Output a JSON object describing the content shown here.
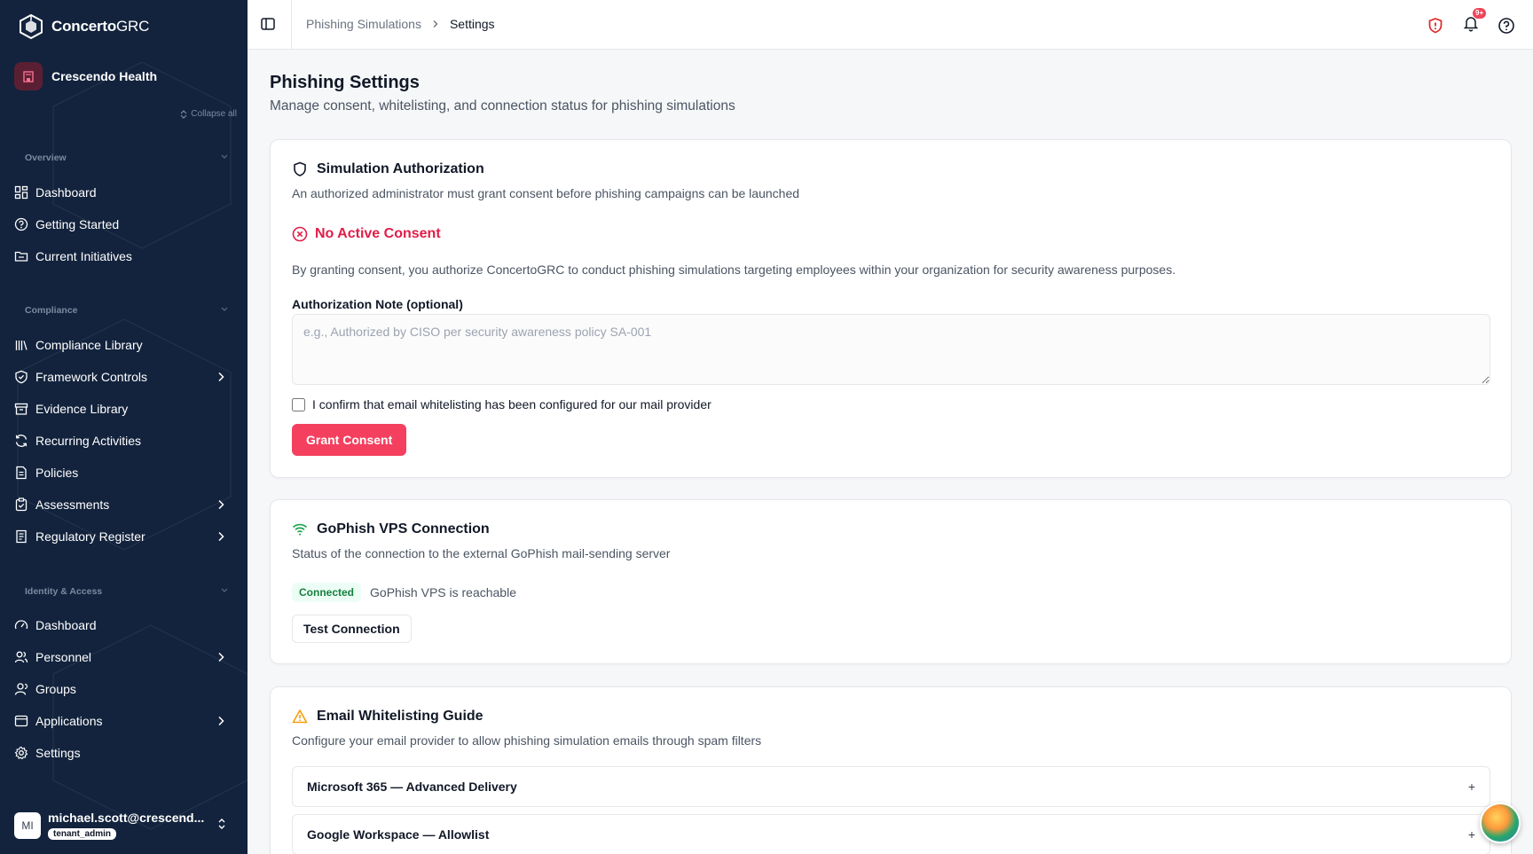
{
  "brand": {
    "name_bold": "Concerto",
    "name_light": "GRC"
  },
  "org": {
    "name": "Crescendo Health"
  },
  "sidebar": {
    "collapse_all": "Collapse all",
    "sections": [
      {
        "label": "Overview",
        "items": [
          {
            "label": "Dashboard",
            "icon": "dashboard-icon"
          },
          {
            "label": "Getting Started",
            "icon": "help-circle-icon"
          },
          {
            "label": "Current Initiatives",
            "icon": "folder-icon"
          }
        ]
      },
      {
        "label": "Compliance",
        "items": [
          {
            "label": "Compliance Library",
            "icon": "library-icon"
          },
          {
            "label": "Framework Controls",
            "icon": "shield-check-icon",
            "has_children": true
          },
          {
            "label": "Evidence Library",
            "icon": "archive-icon"
          },
          {
            "label": "Recurring Activities",
            "icon": "refresh-icon"
          },
          {
            "label": "Policies",
            "icon": "file-text-icon"
          },
          {
            "label": "Assessments",
            "icon": "clipboard-check-icon",
            "has_children": true
          },
          {
            "label": "Regulatory Register",
            "icon": "register-icon",
            "has_children": true
          }
        ]
      },
      {
        "label": "Identity & Access",
        "items": [
          {
            "label": "Dashboard",
            "icon": "gauge-icon"
          },
          {
            "label": "Personnel",
            "icon": "users-icon",
            "has_children": true
          },
          {
            "label": "Groups",
            "icon": "user-group-icon"
          },
          {
            "label": "Applications",
            "icon": "app-window-icon",
            "has_children": true
          },
          {
            "label": "Settings",
            "icon": "gear-icon"
          }
        ]
      }
    ]
  },
  "user": {
    "initials": "MI",
    "email": "michael.scott@crescend...",
    "role": "tenant_admin"
  },
  "topbar": {
    "breadcrumb": [
      "Phishing Simulations",
      "Settings"
    ],
    "notification_count": "9+"
  },
  "page": {
    "title": "Phishing Settings",
    "subtitle": "Manage consent, whitelisting, and connection status for phishing simulations"
  },
  "authorization": {
    "title": "Simulation Authorization",
    "description": "An authorized administrator must grant consent before phishing campaigns can be launched",
    "status": "No Active Consent",
    "consent_text": "By granting consent, you authorize ConcertoGRC to conduct phishing simulations targeting employees within your organization for security awareness purposes.",
    "note_label": "Authorization Note (optional)",
    "note_placeholder": "e.g., Authorized by CISO per security awareness policy SA-001",
    "note_value": "",
    "confirm_label": "I confirm that email whitelisting has been configured for our mail provider",
    "confirm_checked": false,
    "grant_button": "Grant Consent"
  },
  "connection": {
    "title": "GoPhish VPS Connection",
    "description": "Status of the connection to the external GoPhish mail-sending server",
    "status_badge": "Connected",
    "status_text": "GoPhish VPS is reachable",
    "test_button": "Test Connection"
  },
  "whitelisting": {
    "title": "Email Whitelisting Guide",
    "description": "Configure your email provider to allow phishing simulation emails through spam filters",
    "items": [
      {
        "label": "Microsoft 365 — Advanced Delivery",
        "toggle": "+"
      },
      {
        "label": "Google Workspace — Allowlist",
        "toggle": "+"
      }
    ]
  },
  "colors": {
    "sidebar_bg": "#13233d",
    "accent": "#f43f5e",
    "error": "#e11d48",
    "success": "#15803d",
    "warning": "#f59e0b"
  }
}
